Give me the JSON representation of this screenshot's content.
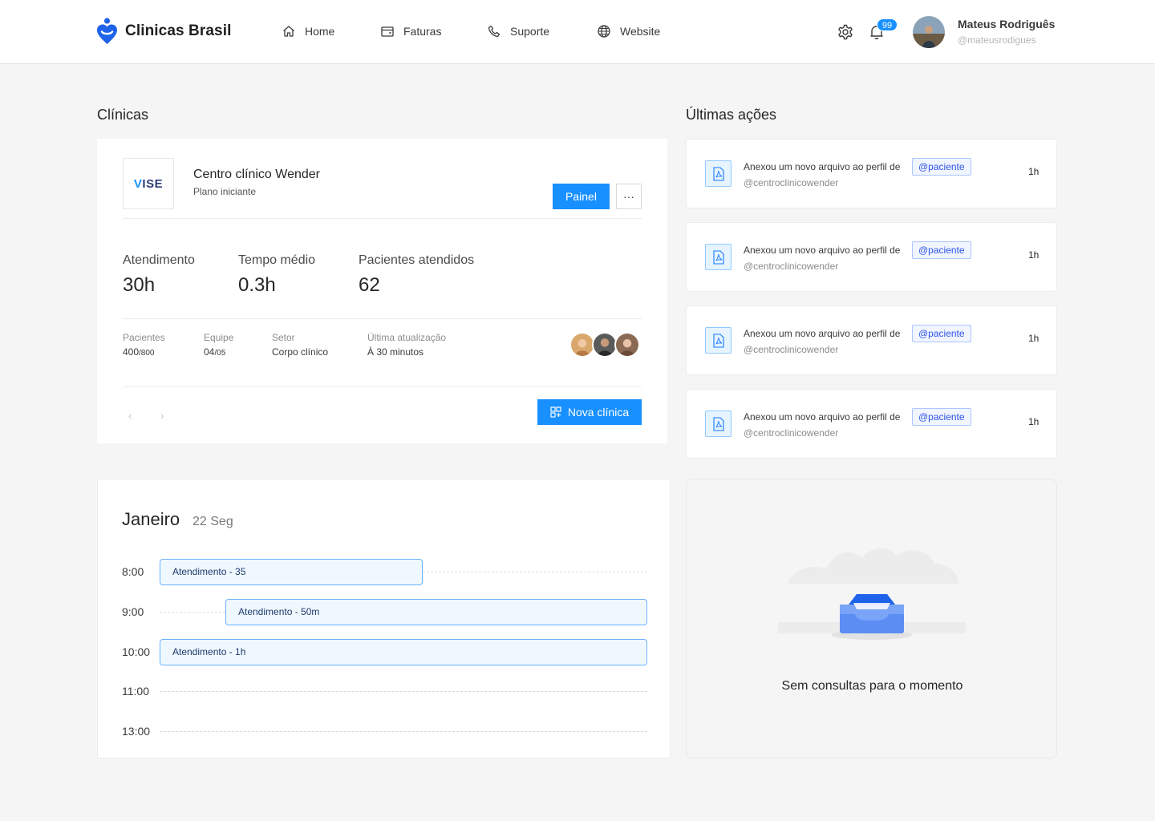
{
  "header": {
    "brand": "Clinicas Brasil",
    "nav": [
      {
        "label": "Home",
        "icon": "home-icon"
      },
      {
        "label": "Faturas",
        "icon": "wallet-icon"
      },
      {
        "label": "Suporte",
        "icon": "phone-icon"
      },
      {
        "label": "Website",
        "icon": "globe-icon"
      }
    ],
    "notifications_count": "99",
    "user": {
      "name": "Mateus Rodriguês",
      "handle": "@mateusrodigues"
    }
  },
  "clinics": {
    "title": "Clínicas",
    "logo_text_accent": "V",
    "logo_text_rest": "ISE",
    "name": "Centro clínico Wender",
    "plan": "Plano iniciante",
    "painel_label": "Painel",
    "more_label": "···",
    "stats": [
      {
        "label": "Atendimento",
        "value": "30h"
      },
      {
        "label": "Tempo médio",
        "value": "0.3h"
      },
      {
        "label": "Pacientes atendidos",
        "value": "62"
      }
    ],
    "meta": [
      {
        "label": "Pacientes",
        "value": "400",
        "suffix": "/800"
      },
      {
        "label": "Equipe",
        "value": "04",
        "suffix": "/05"
      },
      {
        "label": "Setor",
        "value": "Corpo clínico",
        "suffix": ""
      },
      {
        "label": "Última atualização",
        "value": "À 30 minutos",
        "suffix": ""
      }
    ],
    "prev": "‹",
    "next": "›",
    "nova_label": "Nova clínica"
  },
  "actions": {
    "title": "Últimas ações",
    "items": [
      {
        "text": "Anexou um novo arquivo ao perfil de",
        "tag": "@paciente",
        "sub": "@centroclinicowender",
        "time": "1h"
      },
      {
        "text": "Anexou um novo arquivo ao perfil de",
        "tag": "@paciente",
        "sub": "@centroclinicowender",
        "time": "1h"
      },
      {
        "text": "Anexou um novo arquivo ao perfil de",
        "tag": "@paciente",
        "sub": "@centroclinicowender",
        "time": "1h"
      },
      {
        "text": "Anexou um novo arquivo ao perfil de",
        "tag": "@paciente",
        "sub": "@centroclinicowender",
        "time": "1h"
      }
    ]
  },
  "calendar": {
    "month": "Janeiro",
    "day": "22 Seg",
    "times": [
      "8:00",
      "9:00",
      "10:00",
      "11:00",
      "13:00"
    ],
    "events": [
      "Atendimento - 35",
      "Atendimento - 50m",
      "Atendimento - 1h"
    ]
  },
  "empty": {
    "text": "Sem consultas para o momento"
  },
  "colors": {
    "primary": "#1890ff",
    "tag_text": "#2f54eb",
    "background": "#f5f5f5"
  }
}
